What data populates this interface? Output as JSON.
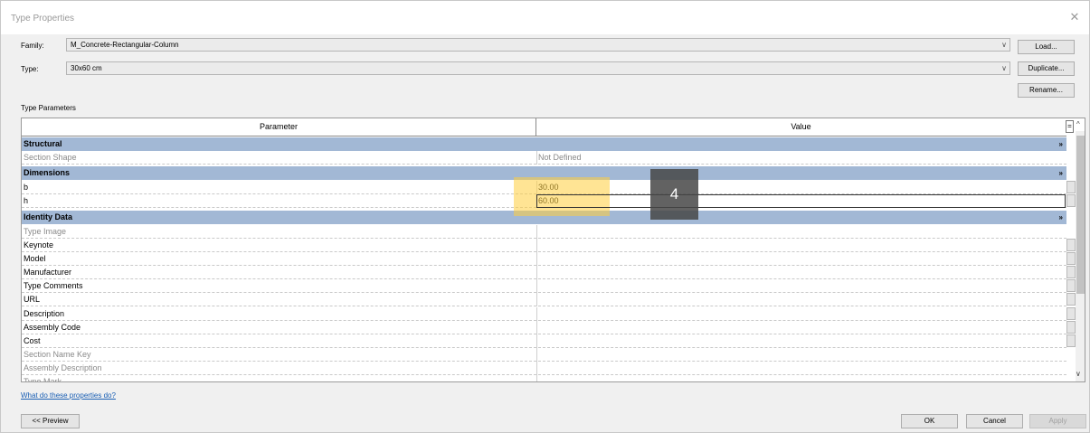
{
  "window": {
    "title": "Type Properties",
    "close_glyph": "✕"
  },
  "family": {
    "label": "Family:",
    "value": "M_Concrete-Rectangular-Column"
  },
  "type": {
    "label": "Type:",
    "value": "30x60 cm"
  },
  "buttons": {
    "load": "Load...",
    "duplicate": "Duplicate...",
    "rename": "Rename...",
    "preview": "<< Preview",
    "ok": "OK",
    "cancel": "Cancel",
    "apply": "Apply"
  },
  "section_label": "Type Parameters",
  "table": {
    "headers": {
      "parameter": "Parameter",
      "value": "Value"
    },
    "sort_glyph": "=",
    "groups": {
      "structural": {
        "name": "Structural"
      },
      "dimensions": {
        "name": "Dimensions"
      },
      "identity": {
        "name": "Identity Data"
      }
    },
    "rows": [
      {
        "param": "Section Shape",
        "value": "Not Defined"
      },
      {
        "param": "b",
        "value": "30.00"
      },
      {
        "param": "h",
        "value": "60.00"
      },
      {
        "param": "Type Image",
        "value": ""
      },
      {
        "param": "Keynote",
        "value": ""
      },
      {
        "param": "Model",
        "value": ""
      },
      {
        "param": "Manufacturer",
        "value": ""
      },
      {
        "param": "Type Comments",
        "value": ""
      },
      {
        "param": "URL",
        "value": ""
      },
      {
        "param": "Description",
        "value": ""
      },
      {
        "param": "Assembly Code",
        "value": ""
      },
      {
        "param": "Cost",
        "value": ""
      },
      {
        "param": "Section Name Key",
        "value": ""
      },
      {
        "param": "Assembly Description",
        "value": ""
      },
      {
        "param": "Type Mark",
        "value": ""
      }
    ]
  },
  "annotation": {
    "step": "4",
    "highlight_color": "#ffcd3c"
  },
  "help_link": "What do these properties do?",
  "icons": {
    "chevron_down": "∨",
    "chevron_up": "^",
    "collapse": "»",
    "close": "✕"
  },
  "colors": {
    "group_header": "#a2b8d5",
    "link": "#1a5fb4"
  }
}
